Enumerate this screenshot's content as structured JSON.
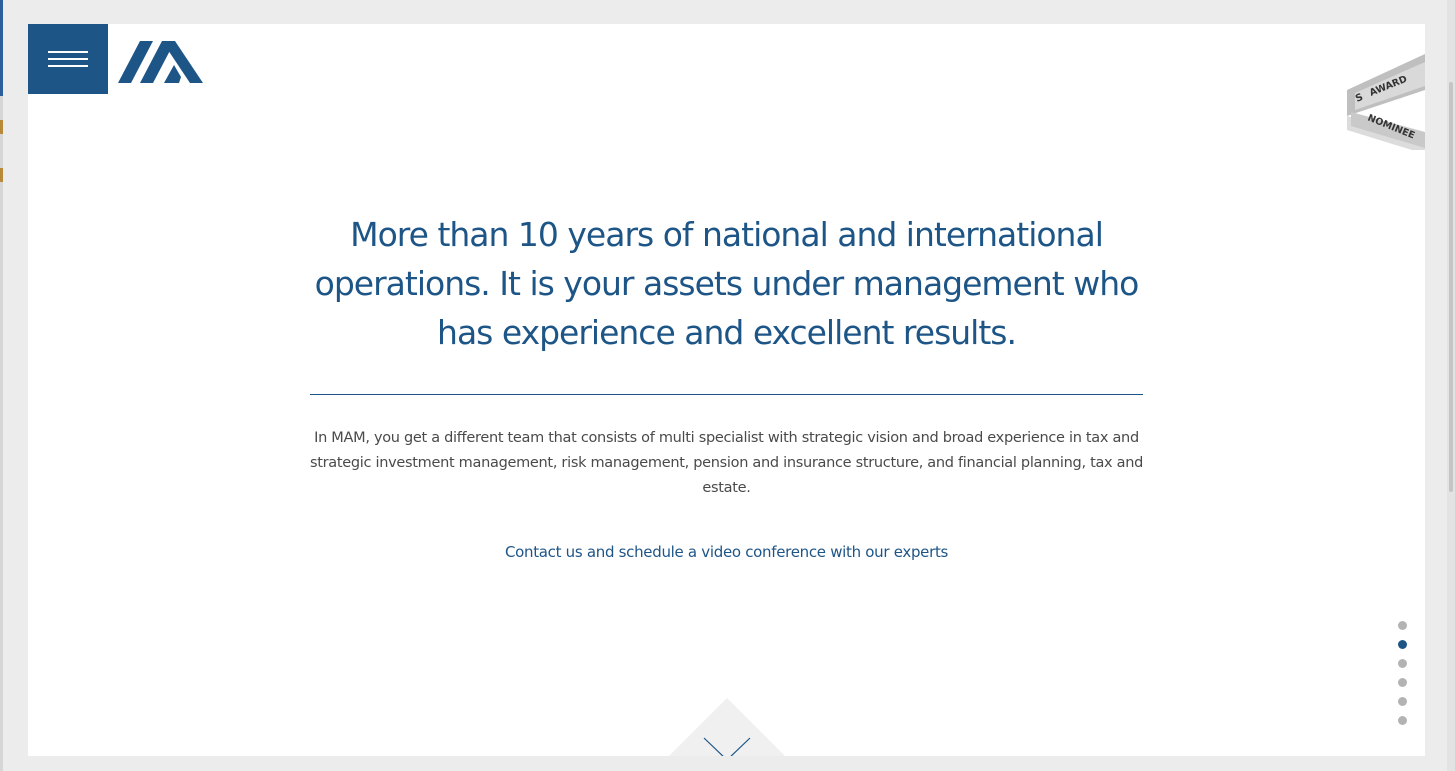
{
  "header": {
    "menu_icon": "hamburger-menu-icon",
    "logo_icon": "mam-logo-icon"
  },
  "award": {
    "top_text": "AWARD",
    "bottom_text": "NOMINEE",
    "icon": "award-ribbon-icon"
  },
  "hero": {
    "headline": "More than 10 years of national and international operations. It is your assets under management who has experience and excellent results.",
    "description": "In MAM, you get a different team that consists of multi specialist with strategic vision and broad experience in tax and strategic investment management, risk management, pension and insurance structure, and financial planning, tax and estate.",
    "contact_link": "Contact us and schedule a video conference with our experts"
  },
  "section_nav": {
    "dot_count": 6,
    "active_index": 1
  },
  "scroll": {
    "icon": "chevron-down-icon"
  },
  "colors": {
    "brand_blue": "#1e5587",
    "text_gray": "#4a4a4a",
    "dot_gray": "#b3b3b3",
    "page_background": "#ffffff",
    "outer_background": "#ececec"
  }
}
